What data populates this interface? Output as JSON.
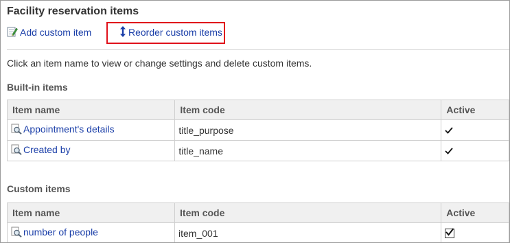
{
  "page": {
    "title": "Facility reservation items",
    "description": "Click an item name to view or change settings and delete custom items."
  },
  "toolbar": {
    "add_label": "Add custom item",
    "reorder_label": "Reorder custom items"
  },
  "builtin": {
    "title": "Built-in items",
    "headers": {
      "name": "Item name",
      "code": "Item code",
      "active": "Active"
    },
    "rows": [
      {
        "name": "Appointment's details",
        "code": "title_purpose",
        "active": true
      },
      {
        "name": "Created by",
        "code": "title_name",
        "active": true
      }
    ]
  },
  "custom": {
    "title": "Custom items",
    "headers": {
      "name": "Item name",
      "code": "Item code",
      "active": "Active"
    },
    "rows": [
      {
        "name": "number of people",
        "code": "item_001",
        "active": true
      }
    ]
  },
  "colors": {
    "link": "#1a3ea8",
    "highlight": "#e0101a",
    "header_bg": "#f0f0f0"
  },
  "icons": {
    "add": "pencil-note-icon",
    "reorder": "up-down-arrow-icon",
    "item": "magnifier-page-icon",
    "active_builtin": "checkmark-icon",
    "active_custom": "checkbox-checked-icon"
  }
}
